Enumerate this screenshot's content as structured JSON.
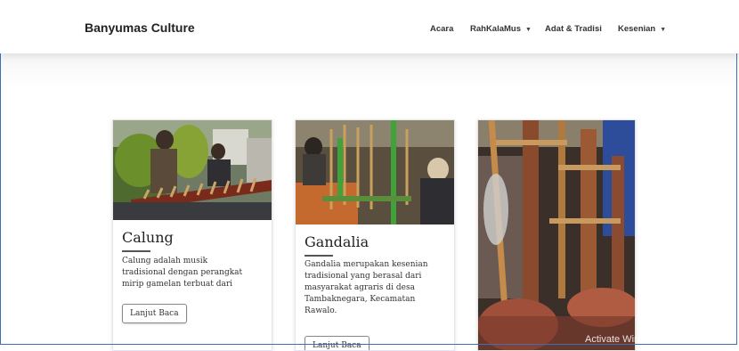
{
  "navbar": {
    "brand": "Banyumas Culture",
    "items": [
      {
        "label": "Acara",
        "dropdown": false
      },
      {
        "label": "RahKalaMus",
        "dropdown": true
      },
      {
        "label": "Adat & Tradisi",
        "dropdown": false
      },
      {
        "label": "Kesenian",
        "dropdown": true
      }
    ]
  },
  "cards": [
    {
      "title": "Calung",
      "text_lines": [
        "Calung adalah musik",
        "tradisional dengan perangkat",
        "mirip gamelan terbuat dari"
      ],
      "button": "Lanjut Baca",
      "image_icon": "calung-photo"
    },
    {
      "title": "Gandalia",
      "text_lines": [
        "Gandalia merupakan kesenian",
        "tradisional yang berasal dari",
        "masyarakat agraris di desa",
        "Tambaknegara, Kecamatan",
        "Rawalo."
      ],
      "button": "Lanjut Baca",
      "image_icon": "gandalia-photo"
    },
    {
      "title": "",
      "image_icon": "angklung-photo"
    }
  ],
  "overlay": {
    "watermark": "Activate Windows"
  }
}
